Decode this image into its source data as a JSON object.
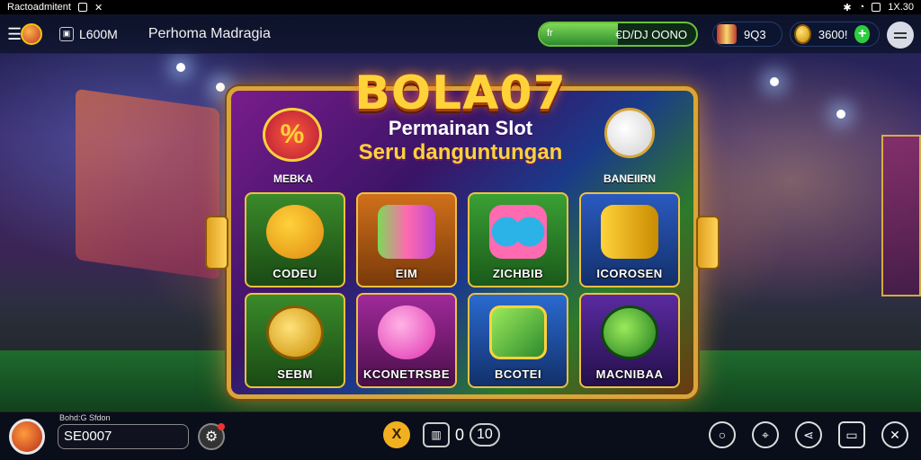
{
  "statusbar": {
    "left_text": "Ractoadmitent",
    "time": "1X.30"
  },
  "header": {
    "user_id": "L600M",
    "game_title": "Perhoma Madragia",
    "progress_left": "fr",
    "progress_text": "€D/DJ OONO",
    "progress_fill": 0.5,
    "wallet1": "9Q3",
    "wallet2": "3600!",
    "plus_label": "+"
  },
  "logo": {
    "title": "BOLA07",
    "subtitle1": "Permainan Slot",
    "subtitle2": "Seru danguntungan"
  },
  "top_tiles": [
    {
      "label": "MEBKA",
      "icon": "percent-icon",
      "color": "#8a1c8a"
    },
    {
      "label": "",
      "icon": "",
      "color": "#1e4a9a"
    },
    {
      "label": "",
      "icon": "",
      "color": "#2d6a20"
    },
    {
      "label": "BANEIIRN",
      "icon": "teapot-icon",
      "color": "#6a3a10"
    }
  ],
  "tiles": [
    {
      "label": "CODEU",
      "icon": "bear-icon",
      "color": "#2a6a2a"
    },
    {
      "label": "EIM",
      "icon": "scroll-icon",
      "color": "#b85a10"
    },
    {
      "label": "ZICHBIB",
      "icon": "binoculars-icon",
      "color": "#2f8a2a"
    },
    {
      "label": "ICOROSEN",
      "icon": "coin-roll-icon",
      "color": "#1d4a9a"
    },
    {
      "label": "SEBM",
      "icon": "gold-coins-icon",
      "color": "#2a7a24"
    },
    {
      "label": "KCONETRSBE",
      "icon": "pink-orb-icon",
      "color": "#8a1c8a"
    },
    {
      "label": "BCOTEI",
      "icon": "green-can-icon",
      "color": "#1f4a9a"
    },
    {
      "label": "MACNIBAA",
      "icon": "green-pot-icon",
      "color": "#4a1c8a"
    }
  ],
  "bottom": {
    "uname_label": "Bohd:G Sfdon",
    "username": "SE0007",
    "x_label": "X",
    "counter_box": "▥",
    "counter_value": "0",
    "counter_pill": "10",
    "right_icons": [
      "circle-icon",
      "location-icon",
      "share-icon",
      "screen-icon",
      "close-icon"
    ]
  }
}
